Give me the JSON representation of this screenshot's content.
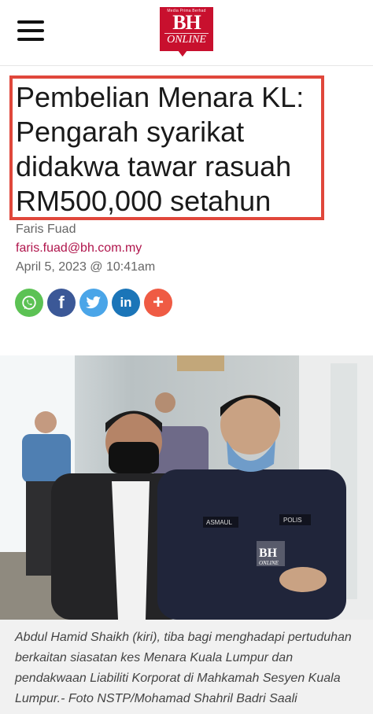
{
  "header": {
    "menu_icon": "hamburger-menu-icon",
    "logo": {
      "tagline": "Media Prima Berhad",
      "main": "BH",
      "sub": "ONLINE",
      "color": "#c8102e"
    }
  },
  "article": {
    "title": "Pembelian Menara KL: Pengarah syarikat didakwa tawar rasuah RM500,000 setahun",
    "author": "Faris Fuad",
    "email": "faris.fuad@bh.com.my",
    "date": "April 5, 2023 @ 10:41am",
    "highlight_color": "#e0473b"
  },
  "share": [
    {
      "name": "whatsapp",
      "icon": "whatsapp-icon",
      "color": "#5cc254"
    },
    {
      "name": "facebook",
      "icon": "facebook-icon",
      "glyph": "f",
      "color": "#3b5897"
    },
    {
      "name": "twitter",
      "icon": "twitter-icon",
      "color": "#4aa5e8"
    },
    {
      "name": "linkedin",
      "icon": "linkedin-icon",
      "glyph": "in",
      "color": "#1b75b8"
    },
    {
      "name": "more",
      "icon": "plus-icon",
      "glyph": "+",
      "color": "#ef5b44"
    }
  ],
  "photo": {
    "watermark_main": "BH",
    "watermark_sub": "ONLINE",
    "badge_name": "ASMAUL",
    "badge_police": "POLIS"
  },
  "caption": "Abdul Hamid Shaikh (kiri), tiba bagi menghadapi pertuduhan berkaitan siasatan kes Menara Kuala Lumpur dan pendakwaan Liabiliti Korporat di Mahkamah Sesyen Kuala Lumpur.- Foto NSTP/Mohamad Shahril Badri Saali"
}
